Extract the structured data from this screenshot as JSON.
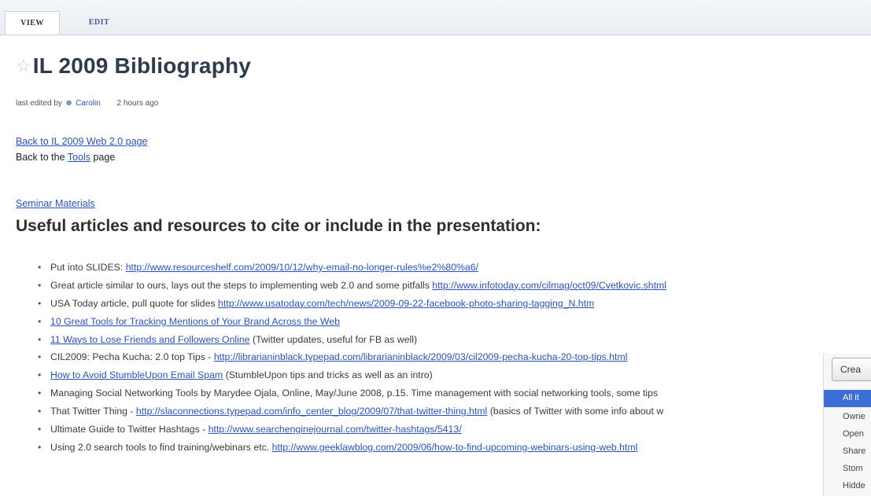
{
  "tabs": {
    "view": "VIEW",
    "edit": "EDIT"
  },
  "page": {
    "star_glyph": "☆",
    "title": "IL 2009 Bibliography",
    "meta_prefix": "last edited by ",
    "meta_user": "Carolin",
    "meta_time": "2 hours ago"
  },
  "nav": {
    "back_web20": "Back to IL 2009 Web 2.0 page",
    "back_tools_prefix": "Back to the ",
    "back_tools_link": "Tools",
    "back_tools_suffix": " page"
  },
  "section": {
    "seminar_link": "Seminar Materials",
    "heading": "Useful articles and resources to cite or include in the presentation:"
  },
  "resources": [
    {
      "pre": "Put into SLIDES: ",
      "link": "http://www.resourceshelf.com/2009/10/12/why-email-no-longer-rules%e2%80%a6/",
      "post": ""
    },
    {
      "pre": "Great article similar to ours, lays out the steps to implementing web 2.0 and some pitfalls ",
      "link": "http://www.infotoday.com/cilmag/oct09/Cvetkovic.shtml",
      "post": ""
    },
    {
      "pre": "USA Today article, pull quote for slides ",
      "link": "http://www.usatoday.com/tech/news/2009-09-22-facebook-photo-sharing-tagging_N.htm",
      "post": ""
    },
    {
      "pre": "",
      "link": "10 Great Tools for Tracking Mentions of Your Brand Across the Web",
      "post": ""
    },
    {
      "pre": "",
      "link": "11 Ways to Lose Friends and Followers Online",
      "post": " (Twitter updates, useful for FB as well)"
    },
    {
      "pre": "CIL2009: Pecha Kucha: 2.0 top Tips - ",
      "link": "http://librarianinblack.typepad.com/librarianinblack/2009/03/cil2009-pecha-kucha-20-top-tips.html",
      "post": ""
    },
    {
      "pre": "",
      "link": "How to Avoid StumbleUpon Email Spam",
      "post": " (StumbleUpon tips and tricks as well as an intro)"
    },
    {
      "pre": "Managing Social Networking Tools by Marydee Ojala, Online, May/June 2008, p.15. Time management with social networking tools, some tips",
      "link": "",
      "post": ""
    },
    {
      "pre": "That Twitter Thing - ",
      "link": "http://slaconnections.typepad.com/info_center_blog/2009/07/that-twitter-thing.html",
      "post": " (basics of Twitter with some info about w"
    },
    {
      "pre": "Ultimate Guide to Twitter Hashtags - ",
      "link": "http://www.searchenginejournal.com/twitter-hashtags/5413/",
      "post": ""
    },
    {
      "pre": "Using 2.0 search tools to find training/webinars etc. ",
      "link": "http://www.geeklawblog.com/2009/06/how-to-find-upcoming-webinars-using-web.html",
      "post": ""
    }
  ],
  "side_panel": {
    "create_label": "Crea",
    "selected": "All it",
    "items": [
      "Owne",
      "Open",
      "Share",
      "Stom",
      "Hidde"
    ]
  }
}
